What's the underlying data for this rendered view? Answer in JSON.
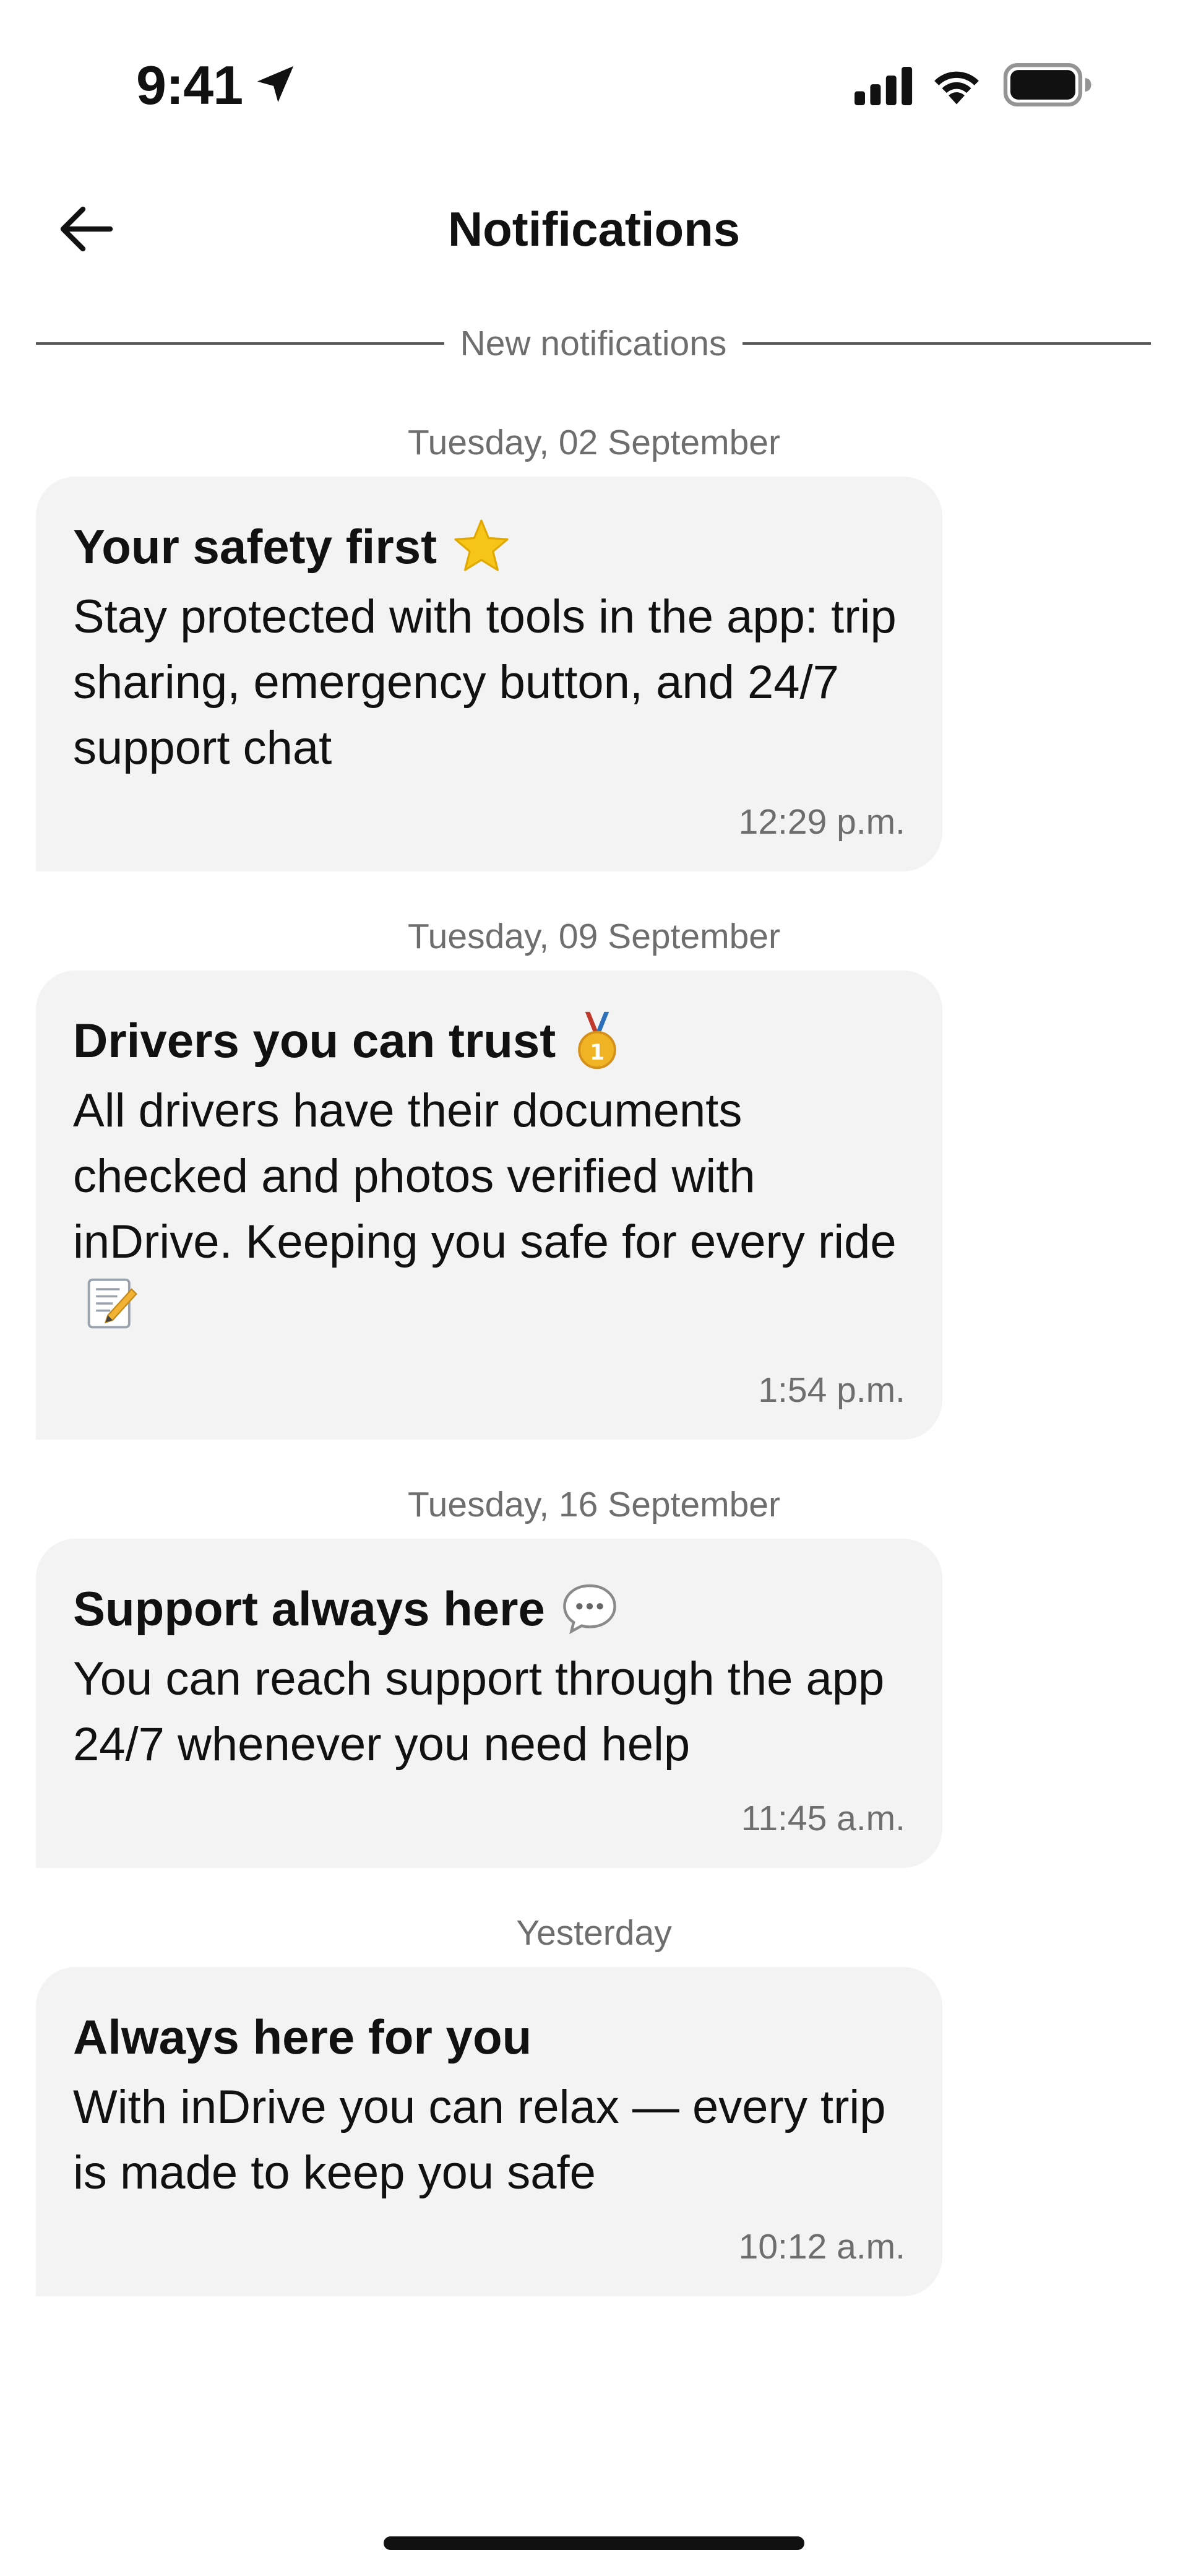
{
  "status_bar": {
    "time": "9:41",
    "icons": [
      "location-arrow-icon",
      "signal-icon",
      "wifi-icon",
      "battery-icon"
    ]
  },
  "header": {
    "back_icon": "arrow-left-icon",
    "title": "Notifications"
  },
  "divider": {
    "label": "New notifications"
  },
  "notifications": [
    {
      "date": "Tuesday, 02 September",
      "title": "Your safety first",
      "title_emoji": "star-icon",
      "body": "Stay protected with tools in the app: trip sharing, emergency button, and 24/7 support chat",
      "time": "12:29 p.m."
    },
    {
      "date": "Tuesday, 09 September",
      "title": "Drivers you can trust",
      "title_emoji": "medal-icon",
      "body": "All drivers have their documents checked and photos verified with inDrive. Keeping you safe for every ride",
      "body_emoji": "memo-icon",
      "time": "1:54 p.m."
    },
    {
      "date": "Tuesday, 16 September",
      "title": "Support always here",
      "title_emoji": "speech-bubble-icon",
      "body": "You can reach support through the app 24/7 whenever you need help",
      "time": "11:45 a.m."
    },
    {
      "date": "Yesterday",
      "title": "Always here for you",
      "body": "With inDrive you can relax — every trip is made to keep you safe",
      "time": "10:12 a.m."
    }
  ],
  "colors": {
    "background": "#ffffff",
    "card": "#f3f3f3",
    "text": "#111111",
    "muted": "#6e6e6e",
    "star": "#f5c518",
    "medal": "#e8a317"
  }
}
